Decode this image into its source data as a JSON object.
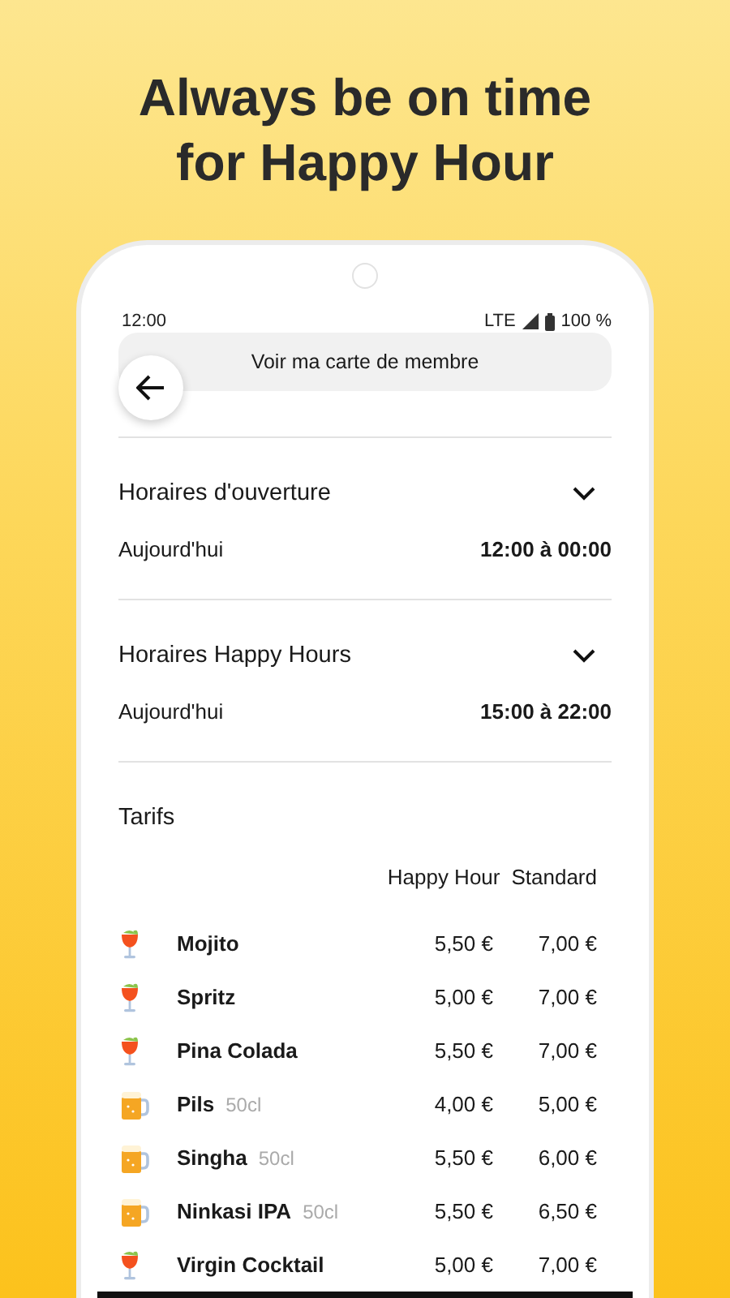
{
  "headline": [
    "Always be on time",
    "for Happy Hour"
  ],
  "status_bar": {
    "time": "12:00",
    "network": "LTE",
    "battery": "100 %"
  },
  "header": {
    "title": "Voir ma carte de membre"
  },
  "sections": [
    {
      "title": "Horaires d'ouverture",
      "day": "Aujourd'hui",
      "hours": "12:00 à 00:00"
    },
    {
      "title": "Horaires Happy Hours",
      "day": "Aujourd'hui",
      "hours": "15:00 à 22:00"
    }
  ],
  "tarifs": {
    "title": "Tarifs",
    "columns": [
      "Happy Hour",
      "Standard"
    ],
    "rows": [
      {
        "kind": "cocktail",
        "name": "Mojito",
        "happy_hour": "5,50 €",
        "standard": "7,00 €"
      },
      {
        "kind": "cocktail",
        "name": "Spritz",
        "happy_hour": "5,00 €",
        "standard": "7,00 €"
      },
      {
        "kind": "cocktail",
        "name": "Pina Colada",
        "happy_hour": "5,50 €",
        "standard": "7,00 €"
      },
      {
        "kind": "beer",
        "name": "Pils",
        "size": "50cl",
        "happy_hour": "4,00 €",
        "standard": "5,00 €"
      },
      {
        "kind": "beer",
        "name": "Singha",
        "size": "50cl",
        "happy_hour": "5,50 €",
        "standard": "6,00 €"
      },
      {
        "kind": "beer",
        "name": "Ninkasi IPA",
        "size": "50cl",
        "happy_hour": "5,50 €",
        "standard": "6,50 €"
      },
      {
        "kind": "cocktail",
        "name": "Virgin Cocktail",
        "happy_hour": "5,00 €",
        "standard": "7,00 €"
      }
    ]
  }
}
